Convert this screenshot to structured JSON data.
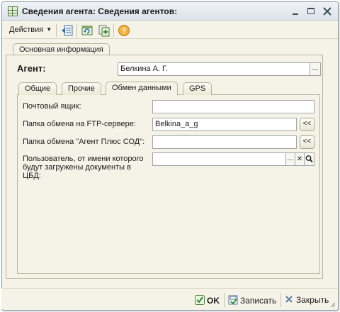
{
  "window": {
    "title": "Сведения агента: Сведения агентов:"
  },
  "toolbar": {
    "actions_label": "Действия",
    "icons": [
      "back-to-list-icon",
      "refresh-icon",
      "copy-icon",
      "help-icon"
    ],
    "help_glyph": "?"
  },
  "main_tab": {
    "label": "Основная информация"
  },
  "agent": {
    "label": "Агент:",
    "value": "Белкина А. Г.",
    "select_button": "..."
  },
  "subtabs": [
    {
      "label": "Общие",
      "active": false
    },
    {
      "label": "Прочие",
      "active": false
    },
    {
      "label": "Обмен данными",
      "active": true
    },
    {
      "label": "GPS",
      "active": false
    }
  ],
  "exchange": {
    "mailbox_label": "Почтовый ящик:",
    "mailbox_value": "",
    "ftp_label": "Папка обмена на FTP-сервере:",
    "ftp_value": "Belkina_a_g",
    "ftp_button": "<<",
    "agent_plus_label": "Папка обмена \"Агент Плюс СОД\":",
    "agent_plus_value": "",
    "agent_plus_button": "<<",
    "user_label_line1": "Пользователь, от имени которого",
    "user_label_line2": "будут загружены документы в",
    "user_label_line3": "ЦБД:",
    "user_value": "",
    "user_select_button": "...",
    "user_clear_button": "✕"
  },
  "footer": {
    "ok_label": "OK",
    "save_label": "Записать",
    "close_label": "Закрыть"
  },
  "colors": {
    "window_bg": "#f5f3e8",
    "titlebar": "#e4e9ef",
    "accent_green": "#2e8b2e",
    "help_orange": "#f0a020"
  }
}
